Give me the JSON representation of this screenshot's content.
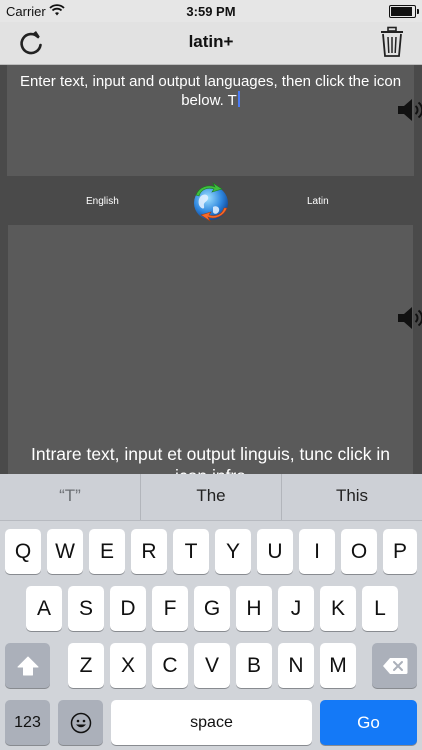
{
  "status": {
    "carrier": "Carrier",
    "time": "3:59 PM",
    "battery_level": 0.9
  },
  "nav": {
    "title": "latin+"
  },
  "input": {
    "text": "Enter text, input and output languages, then click the icon below. T"
  },
  "languages": {
    "from": "English",
    "to": "Latin"
  },
  "output": {
    "text": "Intrare text, input et output linguis, tunc click in icon infra"
  },
  "keyboard": {
    "suggestions": [
      "“T”",
      "The",
      "This"
    ],
    "row1": [
      "Q",
      "W",
      "E",
      "R",
      "T",
      "Y",
      "U",
      "I",
      "O",
      "P"
    ],
    "row2": [
      "A",
      "S",
      "D",
      "F",
      "G",
      "H",
      "J",
      "K",
      "L"
    ],
    "row3": [
      "Z",
      "X",
      "C",
      "V",
      "B",
      "N",
      "M"
    ],
    "numbers_label": "123",
    "space_label": "space",
    "go_label": "Go"
  },
  "icons": [
    "wifi-icon",
    "battery-icon",
    "refresh-icon",
    "trash-icon",
    "speaker-icon",
    "translate-globe-icon",
    "shift-icon",
    "backspace-icon",
    "emoji-icon"
  ],
  "colors": {
    "background": "#4a4a4a",
    "panel": "#5a5a5a",
    "go_key": "#1479f7",
    "caret": "#4a7bf5"
  }
}
